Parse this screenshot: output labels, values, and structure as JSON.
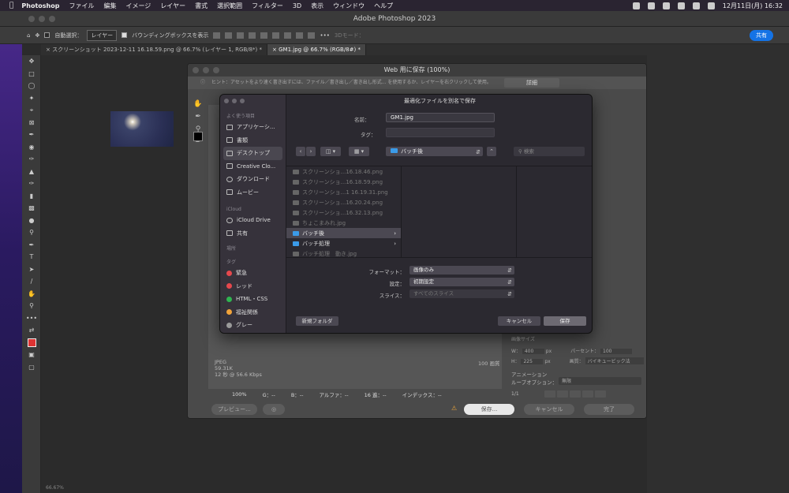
{
  "menubar": {
    "app": "Photoshop",
    "items": [
      "ファイル",
      "編集",
      "イメージ",
      "レイヤー",
      "書式",
      "選択範囲",
      "フィルター",
      "3D",
      "表示",
      "ウィンドウ",
      "ヘルプ"
    ],
    "clock": "12月11日(月) 16:32"
  },
  "window": {
    "title": "Adobe Photoshop 2023"
  },
  "options": {
    "auto_select": "自動選択：",
    "layer_sel": "レイヤー",
    "bbox": "バウンディングボックスを表示",
    "mode3d": "3Dモード：",
    "share": "共有"
  },
  "tabs": [
    {
      "label": "スクリーンショット 2023-12-11 16.18.59.png @ 66.7% (レイヤー 1, RGB/8*) *"
    },
    {
      "label": "GM1.jpg @ 66.7% (RGB/8#) *"
    }
  ],
  "status": {
    "text": "66.67%"
  },
  "sfw": {
    "title": "Web 用に保存 (100%)",
    "hint": "ヒント：アセットをより速く書き出すには、ファイル／書き出し／書き出し形式... を使用するか、レイヤーを右クリックして使用。",
    "detail": "詳細",
    "info_format": "JPEG",
    "info_size": "59.31K",
    "info_speed": "12 秒 @ 56.6 Kbps",
    "quality": "100 画質",
    "zoom": "100%",
    "g": "G：--",
    "b": "B：--",
    "alpha": "アルファ：--",
    "hex": "16 進：--",
    "index": "インデックス：--",
    "preview": "プレビュー...",
    "save": "保存...",
    "cancel": "キャンセル",
    "done": "完了",
    "imgsize": "画像サイズ",
    "w": "W：",
    "w_val": "400",
    "h": "H：",
    "h_val": "225",
    "px": "px",
    "percent": "パーセント：",
    "percent_val": "100",
    "quality_lbl": "画質：",
    "resample": "バイキュービック法",
    "anim": "アニメーション",
    "loop": "ループオプション：",
    "loop_val": "無限",
    "frames": "1/1"
  },
  "finder": {
    "title": "最適化ファイルを別名で保存",
    "name_label": "名前：",
    "name_value": "GM1.jpg",
    "tag_label": "タグ：",
    "location": "バッチ後",
    "search_placeholder": "検索",
    "sidebar": {
      "fav": "よく使う項目",
      "items": [
        "アプリケーシ...",
        "書類",
        "デスクトップ",
        "Creative Clo...",
        "ダウンロード",
        "ムービー"
      ],
      "icloud": "iCloud",
      "icloud_items": [
        "iCloud Drive",
        "共有"
      ],
      "places": "場所",
      "tags": "タグ",
      "tag_items": [
        {
          "label": "緊急",
          "color": "#e5484d"
        },
        {
          "label": "レッド",
          "color": "#e5484d"
        },
        {
          "label": "HTML・CSS",
          "color": "#2fb450"
        },
        {
          "label": "福祉関係",
          "color": "#f2a33a"
        },
        {
          "label": "グレー",
          "color": "#9a9a9a"
        }
      ]
    },
    "files": [
      {
        "label": "スクリーンショ...16.18.46.png",
        "kind": "file"
      },
      {
        "label": "スクリーンショ...16.18.59.png",
        "kind": "file"
      },
      {
        "label": "スクリーンショ...1 16.19.31.png",
        "kind": "file"
      },
      {
        "label": "スクリーンショ...16.20.24.png",
        "kind": "file"
      },
      {
        "label": "スクリーンショ...16.32.13.png",
        "kind": "file"
      },
      {
        "label": "ちょこまみれ.jpg",
        "kind": "file"
      },
      {
        "label": "バッチ後",
        "kind": "folder"
      },
      {
        "label": "バッチ処理",
        "kind": "folder"
      },
      {
        "label": "バッチ処理　動き.jpg",
        "kind": "file"
      }
    ],
    "format_label": "フォーマット：",
    "format_value": "画像のみ",
    "settings_label": "設定：",
    "settings_value": "初期設定",
    "slices_label": "スライス：",
    "slices_value": "すべてのスライス",
    "new_folder": "新規フォルダ",
    "cancel": "キャンセル",
    "save": "保存"
  }
}
